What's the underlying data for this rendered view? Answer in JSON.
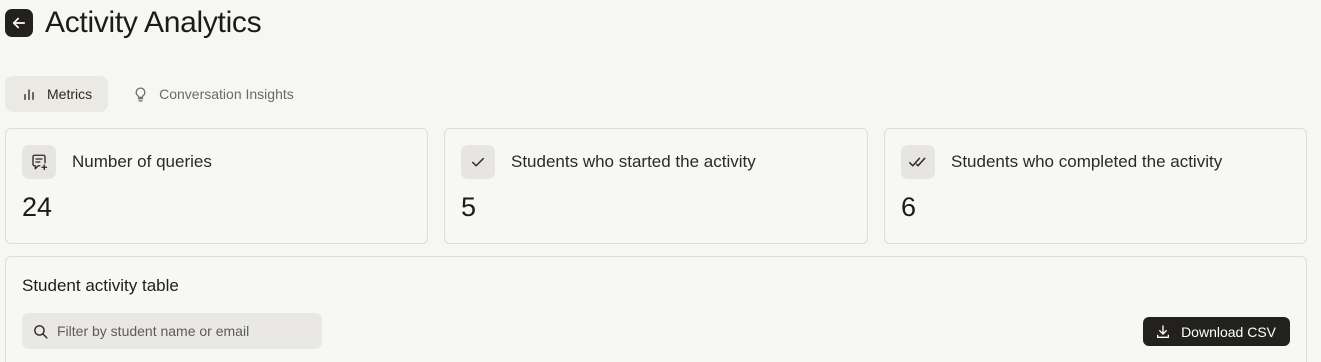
{
  "header": {
    "title": "Activity Analytics",
    "back_icon": "arrow-left-icon"
  },
  "tabs": [
    {
      "label": "Metrics",
      "icon": "bar-chart-icon",
      "active": true
    },
    {
      "label": "Conversation Insights",
      "icon": "lightbulb-icon",
      "active": false
    }
  ],
  "metrics": [
    {
      "label": "Number of queries",
      "value": "24",
      "icon": "message-plus-icon"
    },
    {
      "label": "Students who started the activity",
      "value": "5",
      "icon": "check-icon"
    },
    {
      "label": "Students who completed the activity",
      "value": "6",
      "icon": "double-check-icon"
    }
  ],
  "table": {
    "title": "Student activity table",
    "search_placeholder": "Filter by student name or email",
    "search_value": "",
    "download_label": "Download CSV"
  },
  "colors": {
    "background": "#f6f6f4",
    "primary_button": "#22211f",
    "active_tab": "#ebe9e4",
    "card_border": "#dedcd7"
  }
}
